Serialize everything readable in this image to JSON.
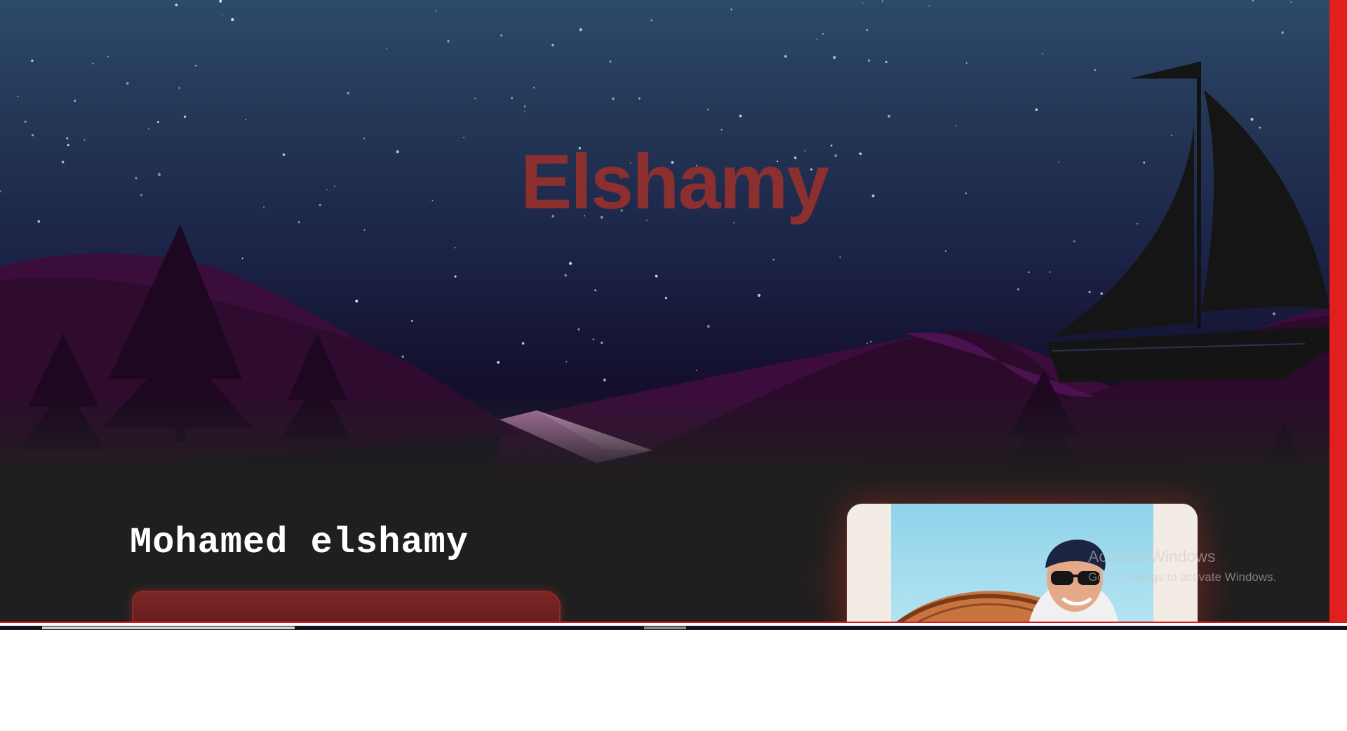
{
  "hero": {
    "title": "Elshamy",
    "title_color": "#8b2f2f"
  },
  "about": {
    "name": "Mohamed elshamy",
    "button_color": "#7c2626"
  },
  "watermark": {
    "line1": "Activate Windows",
    "line2": "Go to Settings to activate Windows."
  },
  "theme": {
    "frame_color": "#e11f1f",
    "section_bg": "#1f1f1f"
  }
}
